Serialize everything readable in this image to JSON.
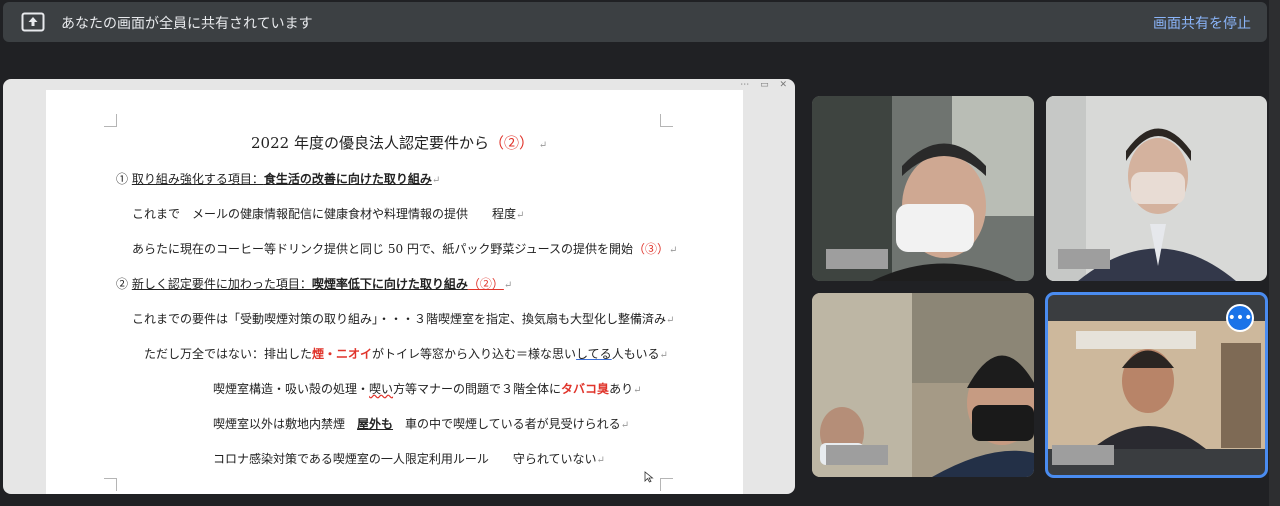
{
  "banner": {
    "message": "あなたの画面が全員に共有されています",
    "stop_label": "画面共有を停止",
    "icon": "present-to-all-icon"
  },
  "document": {
    "title_main": "2022 年度の優良法人認定要件から",
    "title_num": "（②）",
    "section1_prefix": "① ",
    "section1_label": "取り組み強化する項目：",
    "section1_topic": "食生活の改善に向けた取り組み",
    "line1": "これまで　メールの健康情報配信に健康食材や料理情報の提供　　程度",
    "line2_text": "あらたに現在のコーヒー等ドリンク提供と同じ 50 円で、紙パック野菜ジュースの提供を開始",
    "line2_num": "（③）",
    "section2_prefix": "② ",
    "section2_label": "新しく認定要件に加わった項目：",
    "section2_topic": "喫煙率低下に向けた取り組み",
    "section2_num": "（②）",
    "line3": "これまでの要件は「受動喫煙対策の取り組み」・・・３階喫煙室を指定、換気扇も大型化し整備済み",
    "line4_a": "ただし万全ではない：排出した",
    "line4_red": "煙・ニオイ",
    "line4_b": "がトイレ等窓から入り込む＝様な思い",
    "line4_c": "してる",
    "line4_d": "人もいる",
    "line5_a": "喫煙室構造・吸い殻の処理・",
    "line5_b": "喫い",
    "line5_c": "方等マナーの問題で３階全体に",
    "line5_red": "タバコ臭",
    "line5_d": "あり",
    "line6_a": "喫煙室以外は敷地内禁煙　",
    "line6_b": "屋外も",
    "line6_c": "　車の中で喫煙している者が見受けられる",
    "line7": "コロナ感染対策である喫煙室の一人限定利用ルール　　守られていない",
    "para_mark": "↵",
    "window_controls": "⋯ ▭ ✕"
  },
  "participants": {
    "more_options_icon": "more-options-icon",
    "tiles": [
      "participant-1",
      "participant-2",
      "participant-3",
      "participant-4"
    ]
  },
  "colors": {
    "accent": "#4a8cf0",
    "highlight_red": "#e0342b",
    "link_blue": "#8ab4f8"
  }
}
